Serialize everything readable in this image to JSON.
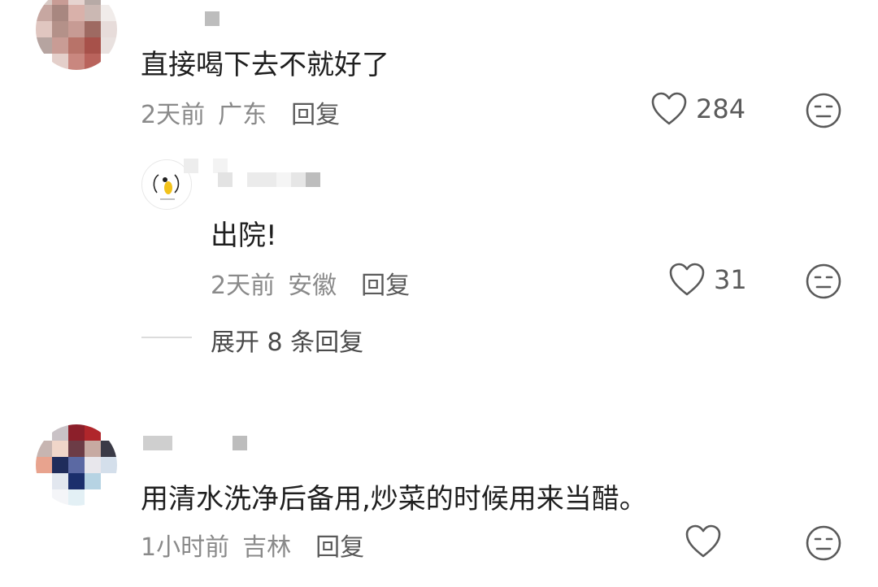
{
  "comments": [
    {
      "text": "直接喝下去不就好了",
      "time": "2天前",
      "location": "广东",
      "reply_label": "回复",
      "likes": "284",
      "replies": [
        {
          "text": "出院!",
          "time": "2天前",
          "location": "安徽",
          "reply_label": "回复",
          "likes": "31"
        }
      ],
      "expand_label": "展开 8 条回复"
    },
    {
      "text": "用清水洗净后备用,炒菜的时候用来当醋。",
      "time": "1小时前",
      "location": "吉林",
      "reply_label": "回复",
      "likes": ""
    }
  ],
  "icons": {
    "like": "heart-outline-icon",
    "dislike": "neutral-face-icon"
  },
  "colors": {
    "text_primary": "#1f1f1f",
    "text_secondary": "#8a8a8a",
    "icon": "#5a5a5a"
  }
}
